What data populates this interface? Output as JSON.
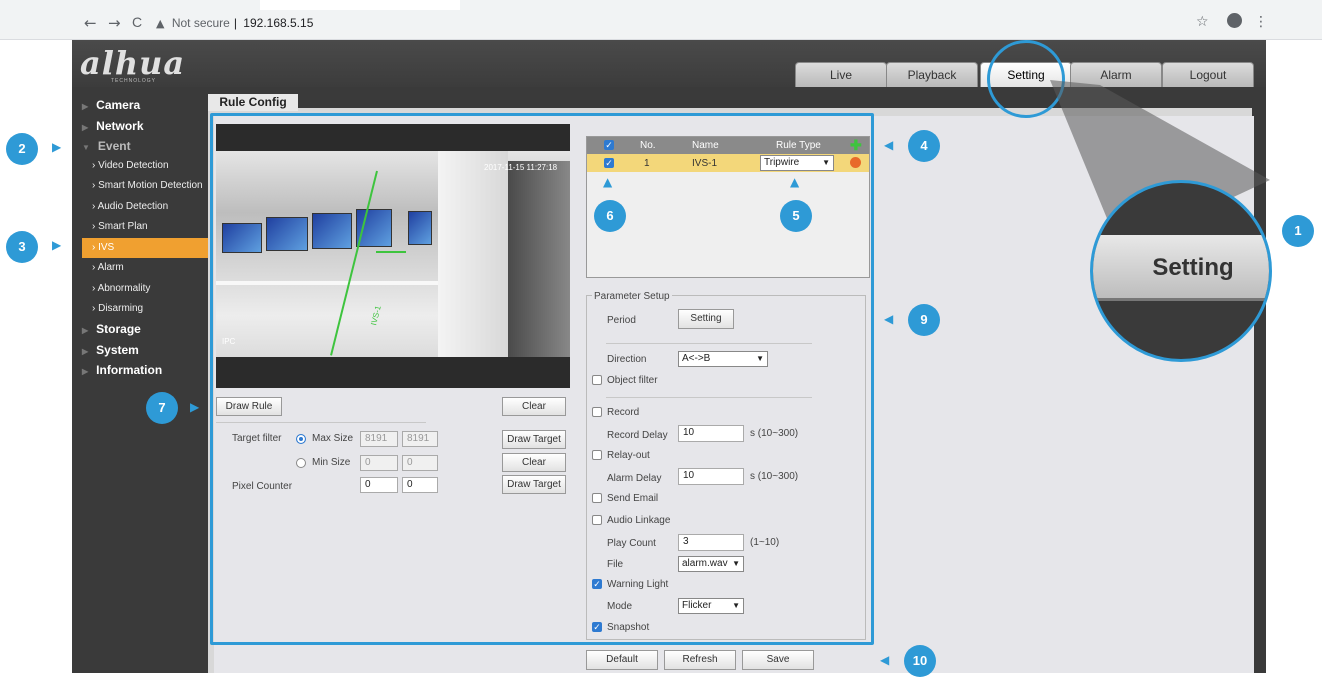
{
  "browser": {
    "back": "←",
    "forward": "→",
    "reload": "C",
    "security": "Not secure",
    "url": "192.168.5.15",
    "star": "☆",
    "menu": "⋮"
  },
  "app": {
    "logo": "alhua",
    "logo_sub": "TECHNOLOGY",
    "top_tabs": [
      "Live",
      "Playback",
      "Setting",
      "Alarm",
      "Logout"
    ],
    "active_tab": "Setting"
  },
  "sidebar": {
    "items": [
      "Camera",
      "Network",
      "Event",
      "Storage",
      "System",
      "Information"
    ],
    "event_subs": [
      "Video Detection",
      "Smart Motion Detection",
      "Audio Detection",
      "Smart Plan",
      "IVS",
      "Alarm",
      "Abnormality",
      "Disarming"
    ],
    "active_sub": "IVS"
  },
  "content": {
    "tab": "Rule Config",
    "video_timestamp": "2017-11-15 11:27:18",
    "video_label": "IPC",
    "line_label": "IVS-1",
    "draw_rule": "Draw Rule",
    "clear": "Clear",
    "target_filter": "Target filter",
    "max_size": "Max Size",
    "min_size": "Min Size",
    "max_w": "8191",
    "max_h": "8191",
    "min_w": "0",
    "min_h": "0",
    "times": "*",
    "draw_target": "Draw Target",
    "clear2": "Clear",
    "pixel_counter": "Pixel Counter",
    "pc_w": "0",
    "pc_h": "0",
    "draw_target2": "Draw Target"
  },
  "rule_table": {
    "headers": [
      "No.",
      "Name",
      "Rule Type"
    ],
    "row": {
      "no": "1",
      "name": "IVS-1",
      "type": "Tripwire"
    }
  },
  "params": {
    "legend": "Parameter Setup",
    "period": "Period",
    "setting_btn": "Setting",
    "direction": "Direction",
    "direction_val": "A<->B",
    "object_filter": "Object filter",
    "record": "Record",
    "record_delay": "Record Delay",
    "record_delay_val": "10",
    "record_delay_unit": "s (10~300)",
    "relay_out": "Relay-out",
    "alarm_delay": "Alarm Delay",
    "alarm_delay_val": "10",
    "alarm_delay_unit": "s (10~300)",
    "send_email": "Send Email",
    "audio_linkage": "Audio Linkage",
    "play_count": "Play Count",
    "play_count_val": "3",
    "play_count_unit": "(1~10)",
    "file": "File",
    "file_val": "alarm.wav",
    "warning_light": "Warning Light",
    "mode": "Mode",
    "mode_val": "Flicker",
    "snapshot": "Snapshot"
  },
  "footer_buttons": [
    "Default",
    "Refresh",
    "Save"
  ],
  "callouts": [
    "1",
    "2",
    "3",
    "4",
    "5",
    "6",
    "7",
    "9",
    "10"
  ],
  "zoom_label": "Setting",
  "accent_color": "#2e9ad6"
}
